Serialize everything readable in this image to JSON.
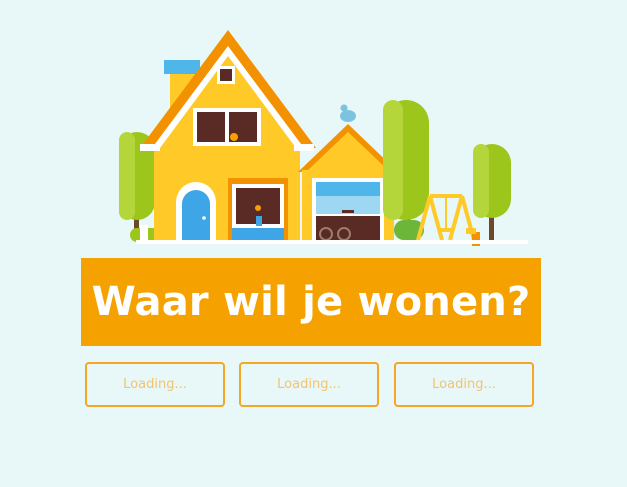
{
  "banner": {
    "title": "Waar wil je wonen?"
  },
  "choices": [
    {
      "label": "Loading..."
    },
    {
      "label": "Loading..."
    },
    {
      "label": "Loading..."
    }
  ],
  "illustration": {
    "subject": "house-with-garage-trees-and-swing"
  },
  "colors": {
    "background": "#e8f7f7",
    "accent": "#f5a200",
    "house": "#ffc928",
    "roof_trim": "#f39200",
    "door": "#3ea6e6",
    "tree": "#9cc61b",
    "button_text": "#f3c46e"
  }
}
